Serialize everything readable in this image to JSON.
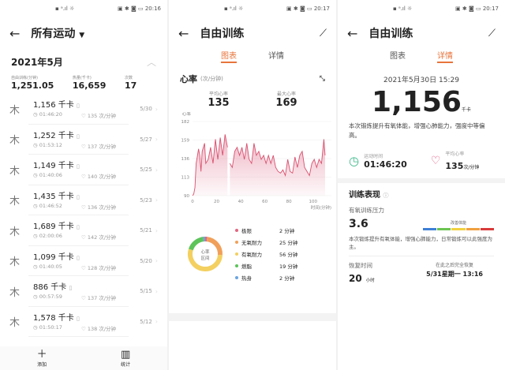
{
  "status": [
    {
      "icons": "▪ ᵃ.ıl ☼",
      "right": "▣ ✱ ◙ ▭ 20:16"
    },
    {
      "icons": "▪ ᵃ.ıl ☼",
      "right": "▣ ✱ ◙ ▭ 20:17"
    },
    {
      "icons": "▪ ᵃ.ıl ☼",
      "right": "▣ ✱ ◙ ▭ 20:17"
    }
  ],
  "list": {
    "title": "所有运动",
    "month": "2021年5月",
    "summary": [
      {
        "label": "自由训练(分钟)",
        "value": "1,251.05"
      },
      {
        "label": "热量(千卡)",
        "value": "16,659"
      },
      {
        "label": "次数",
        "value": "17"
      }
    ],
    "items": [
      {
        "cal": "1,156 千卡",
        "time": "01:46:20",
        "hr": "135 次/分钟",
        "date": "5/30"
      },
      {
        "cal": "1,252 千卡",
        "time": "01:53:12",
        "hr": "137 次/分钟",
        "date": "5/27"
      },
      {
        "cal": "1,149 千卡",
        "time": "01:40:06",
        "hr": "140 次/分钟",
        "date": "5/25"
      },
      {
        "cal": "1,435 千卡",
        "time": "01:46:52",
        "hr": "136 次/分钟",
        "date": "5/23"
      },
      {
        "cal": "1,689 千卡",
        "time": "02:00:06",
        "hr": "142 次/分钟",
        "date": "5/21"
      },
      {
        "cal": "1,099 千卡",
        "time": "01:40:05",
        "hr": "128 次/分钟",
        "date": "5/20"
      },
      {
        "cal": "886 千卡",
        "time": "00:57:59",
        "hr": "137 次/分钟",
        "date": "5/15"
      },
      {
        "cal": "1,578 千卡",
        "time": "01:50:17",
        "hr": "138 次/分钟",
        "date": "5/12"
      }
    ],
    "add": "添加",
    "stats": "统计"
  },
  "detail": {
    "title": "自由训练",
    "tab_chart": "图表",
    "tab_detail": "详情"
  },
  "chart_panel": {
    "hr_title": "心率",
    "hr_unit": "(次/分钟)",
    "avg_label": "平均心率",
    "avg": "135",
    "max_label": "最大心率",
    "max": "169",
    "zone_center": "心率\n区间",
    "zones": [
      {
        "name": "极限",
        "value": "2 分钟",
        "min": 2,
        "color": "#e2677f"
      },
      {
        "name": "无氧耐力",
        "value": "25 分钟",
        "min": 25,
        "color": "#f0a05a"
      },
      {
        "name": "有氧耐力",
        "value": "56 分钟",
        "min": 56,
        "color": "#f3d060"
      },
      {
        "name": "燃脂",
        "value": "19 分钟",
        "min": 19,
        "color": "#5cc45a"
      },
      {
        "name": "热身",
        "value": "2 分钟",
        "min": 2,
        "color": "#6aa5e0"
      }
    ]
  },
  "chart_data": {
    "type": "area",
    "ylabel": "心率",
    "xlabel": "时间(分钟)",
    "ylim": [
      90,
      182
    ],
    "xlim": [
      0,
      110
    ],
    "yticks": [
      90,
      113,
      136,
      159,
      182
    ],
    "xticks": [
      0,
      20,
      40,
      60,
      80,
      100
    ],
    "x": [
      0,
      1,
      2,
      3,
      5,
      6,
      7,
      8,
      10,
      11,
      13,
      15,
      17,
      19,
      21,
      23,
      25,
      27,
      29,
      31,
      33,
      35,
      37,
      39,
      41,
      43,
      45,
      47,
      49,
      51,
      53,
      55,
      57,
      59,
      61,
      63,
      65,
      67,
      69,
      71,
      73,
      75,
      77,
      79,
      81,
      83,
      85,
      87,
      89,
      91,
      93,
      95,
      97,
      99,
      101,
      103,
      105,
      107,
      109,
      110
    ],
    "y": [
      90,
      92,
      100,
      130,
      148,
      140,
      120,
      145,
      155,
      130,
      135,
      150,
      130,
      160,
      135,
      162,
      140,
      166,
      150,
      130,
      125,
      145,
      150,
      140,
      150,
      135,
      155,
      135,
      130,
      155,
      140,
      145,
      135,
      140,
      130,
      140,
      130,
      140,
      125,
      120,
      118,
      122,
      115,
      135,
      120,
      118,
      138,
      125,
      140,
      145,
      125,
      120,
      115,
      130,
      135,
      125,
      135,
      130,
      160,
      140
    ],
    "gap_after": 29,
    "color": "#d9506e"
  },
  "info": {
    "datetime": "2021年5月30日 15:29",
    "calories": "1,156",
    "cal_unit": "千卡",
    "desc": "本次锻炼提升有氧体能，增强心肺能力，强度中等偏高。",
    "time_label": "运动时间",
    "time": "01:46:20",
    "hr_label": "平均心率",
    "hr": "135",
    "hr_unit": "次/分钟",
    "perf_title": "训练表现",
    "stress_label": "有氧训练压力",
    "stress": "3.6",
    "bar_label": "改善体能",
    "stress_desc": "本次锻炼提升有氧体能，增强心肺能力，日常锻炼可以此强度为主。",
    "rec_label": "恢复时间",
    "rec": "20",
    "rec_unit": "小时",
    "full_label": "在此之后完全恢复",
    "full": "5/31星期一 13:16"
  }
}
